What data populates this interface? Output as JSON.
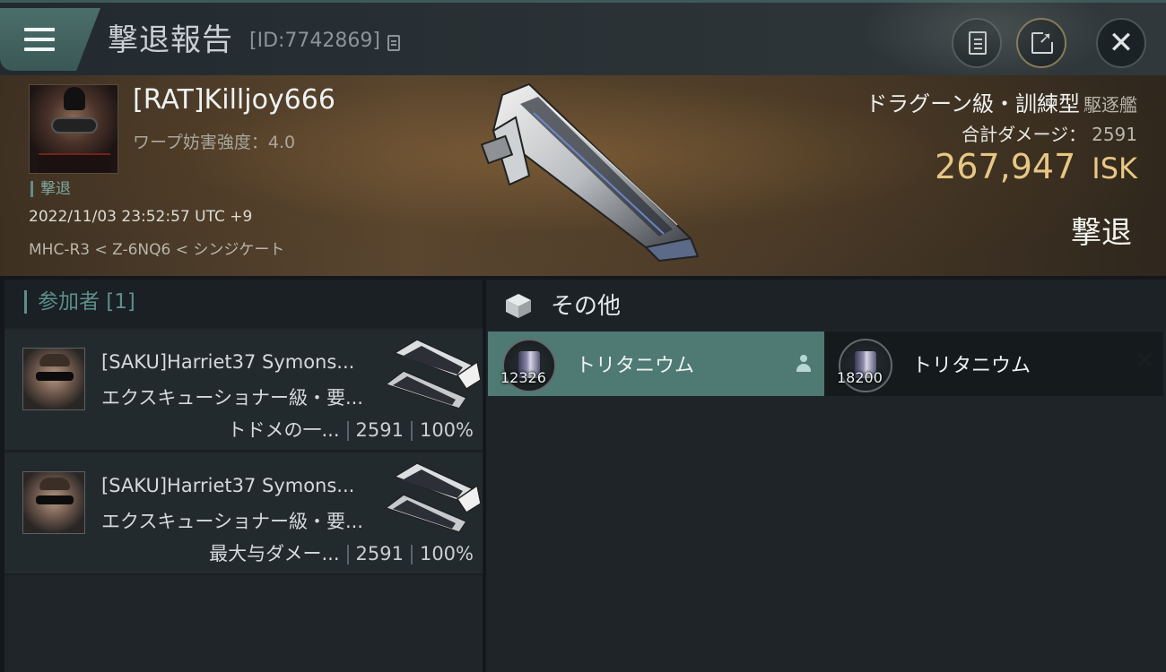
{
  "header": {
    "title": "撃退報告",
    "report_id": "[ID:7742869]",
    "icons": {
      "menu": "hamburger-menu-icon",
      "copy": "copy-icon",
      "notes": "clipboard-notes-icon",
      "share": "share-external-icon",
      "close": "close-icon"
    },
    "close_glyph": "✕"
  },
  "victim": {
    "name": "[RAT]Killjoy666",
    "warp_disruption": "ワープ妨害強度：4.0",
    "status_tag": "撃退",
    "timestamp": "2022/11/03 23:52:57 UTC +9",
    "location": "MHC-R3 < Z-6NQ6 < シンジケート",
    "ship_class": "ドラグーン級・訓練型",
    "ship_role": "駆逐艦",
    "total_damage_label": "合計ダメージ：",
    "total_damage_value": "2591",
    "isk_value": "267,947",
    "isk_unit": "ISK",
    "result": "撃退"
  },
  "participants": {
    "title": "参加者 [1]",
    "items": [
      {
        "name": "[SAKU]Harriet37 Symons...",
        "ship": "エクスキューショナー級・要...",
        "label": "トドメの一...",
        "damage": "2591",
        "percent": "100%"
      },
      {
        "name": "[SAKU]Harriet37 Symons...",
        "ship": "エクスキューショナー級・要...",
        "label": "最大与ダメー...",
        "damage": "2591",
        "percent": "100%"
      }
    ]
  },
  "other": {
    "title": "その他",
    "items": [
      {
        "name": "トリタニウム",
        "quantity": "12326",
        "selected": true
      },
      {
        "name": "トリタニウム",
        "quantity": "18200",
        "selected": false
      }
    ],
    "remove_glyph": "✕"
  },
  "colors": {
    "accent": "#4f7a74",
    "isk_gold": "#e8c785",
    "teal_text": "#5d8f8a"
  }
}
